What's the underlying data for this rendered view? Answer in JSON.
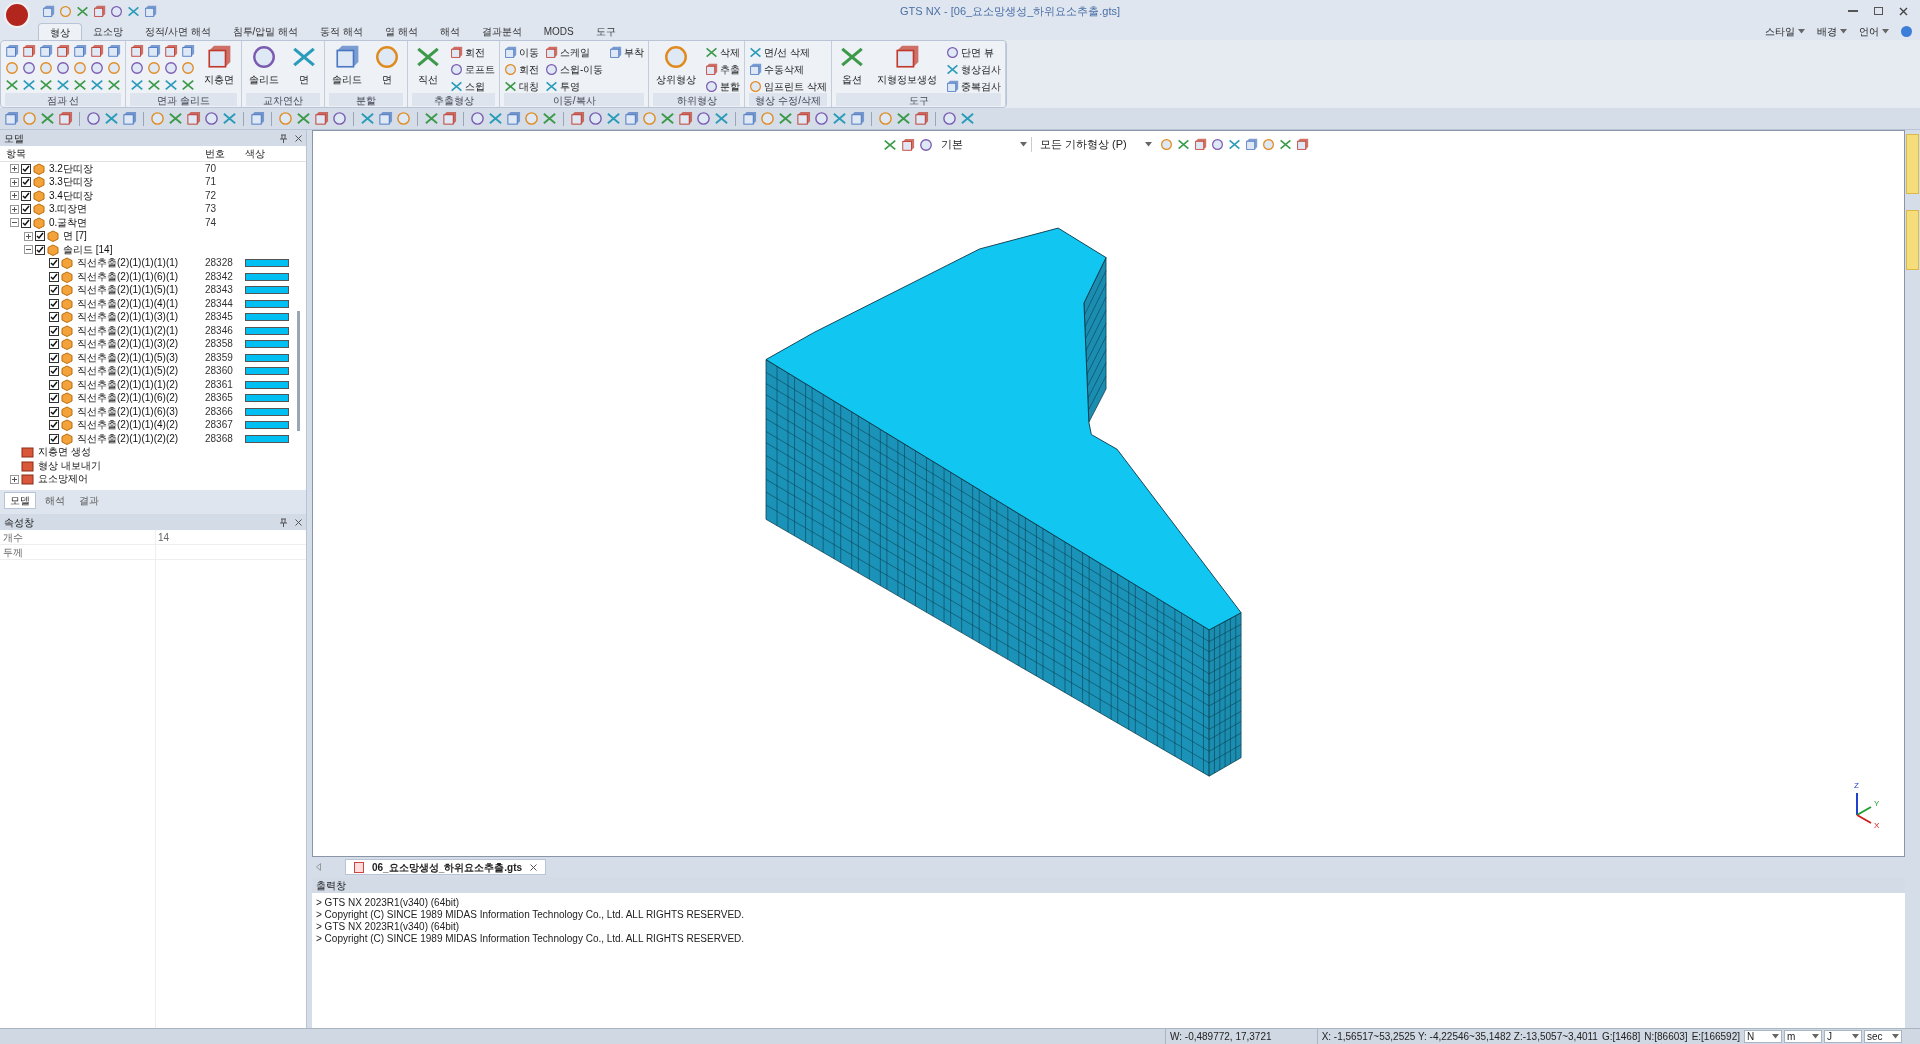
{
  "window": {
    "title": "GTS NX - [06_요소망생성_하위요소추출.gts]"
  },
  "menu_tabs": [
    {
      "label": "형상",
      "selected": true
    },
    {
      "label": "요소망",
      "selected": false
    },
    {
      "label": "정적/사면 해석",
      "selected": false
    },
    {
      "label": "침투/압밀 해석",
      "selected": false
    },
    {
      "label": "동적 해석",
      "selected": false
    },
    {
      "label": "열 해석",
      "selected": false
    },
    {
      "label": "해석",
      "selected": false
    },
    {
      "label": "결과분석",
      "selected": false
    },
    {
      "label": "MODS",
      "selected": false
    },
    {
      "label": "도구",
      "selected": false
    }
  ],
  "top_right_menus": [
    "스타일",
    "배경",
    "언어"
  ],
  "ribbon_groups": [
    {
      "label": "점과 선"
    },
    {
      "label": "면과 솔리드",
      "large": [
        "지층면"
      ]
    },
    {
      "label": "교차연산",
      "large": [
        "솔리드",
        "면"
      ]
    },
    {
      "label": "분할",
      "large": [
        "솔리드",
        "면"
      ]
    },
    {
      "label": "추출형상",
      "large": [
        "직선"
      ],
      "small": [
        "회전",
        "로프트",
        "스윕"
      ]
    },
    {
      "label": "이동/복사",
      "small": [
        "이동",
        "회전",
        "대칭",
        "스케일",
        "스윕-이동",
        "투영",
        "부착"
      ]
    },
    {
      "label": "하위형상",
      "large": [
        "상위형상"
      ],
      "small": [
        "삭제",
        "추출",
        "분할"
      ]
    },
    {
      "label": "형상 수정/삭제",
      "small": [
        "면/선 삭제",
        "수동삭제",
        "임프린트 삭제"
      ]
    },
    {
      "label": "도구",
      "large": [
        "옵션",
        "지형정보생성"
      ],
      "small": [
        "단면 뷰",
        "형상검사",
        "중복검사"
      ]
    }
  ],
  "model_panel": {
    "title": "모델",
    "columns": [
      "항목",
      "번호",
      "색상"
    ],
    "tree": [
      {
        "kind": "group",
        "label": "3.2단띠장",
        "number": "70",
        "checked": true,
        "expanded": false
      },
      {
        "kind": "group",
        "label": "3.3단띠장",
        "number": "71",
        "checked": true,
        "expanded": false
      },
      {
        "kind": "group",
        "label": "3.4단띠장",
        "number": "72",
        "checked": true,
        "expanded": false
      },
      {
        "kind": "group",
        "label": "3.띠장면",
        "number": "73",
        "checked": true,
        "expanded": false
      },
      {
        "kind": "group",
        "label": "0.굴착면",
        "number": "74",
        "checked": true,
        "expanded": true,
        "children": [
          {
            "kind": "group",
            "label": "면 [7]",
            "checked": true,
            "expanded": false
          },
          {
            "kind": "group",
            "label": "솔리드 [14]",
            "checked": true,
            "expanded": true,
            "children": [
              {
                "kind": "solid",
                "label": "직선추출(2)(1)(1)(1)(1)",
                "number": "28328",
                "checked": true,
                "color": "#00bff3"
              },
              {
                "kind": "solid",
                "label": "직선추출(2)(1)(1)(6)(1)",
                "number": "28342",
                "checked": true,
                "color": "#00bff3"
              },
              {
                "kind": "solid",
                "label": "직선추출(2)(1)(1)(5)(1)",
                "number": "28343",
                "checked": true,
                "color": "#00bff3"
              },
              {
                "kind": "solid",
                "label": "직선추출(2)(1)(1)(4)(1)",
                "number": "28344",
                "checked": true,
                "color": "#00bff3"
              },
              {
                "kind": "solid",
                "label": "직선추출(2)(1)(1)(3)(1)",
                "number": "28345",
                "checked": true,
                "color": "#00bff3"
              },
              {
                "kind": "solid",
                "label": "직선추출(2)(1)(1)(2)(1)",
                "number": "28346",
                "checked": true,
                "color": "#00bff3"
              },
              {
                "kind": "solid",
                "label": "직선추출(2)(1)(1)(3)(2)",
                "number": "28358",
                "checked": true,
                "color": "#00bff3"
              },
              {
                "kind": "solid",
                "label": "직선추출(2)(1)(1)(5)(3)",
                "number": "28359",
                "checked": true,
                "color": "#00bff3"
              },
              {
                "kind": "solid",
                "label": "직선추출(2)(1)(1)(5)(2)",
                "number": "28360",
                "checked": true,
                "color": "#00bff3"
              },
              {
                "kind": "solid",
                "label": "직선추출(2)(1)(1)(1)(2)",
                "number": "28361",
                "checked": true,
                "color": "#00bff3"
              },
              {
                "kind": "solid",
                "label": "직선추출(2)(1)(1)(6)(2)",
                "number": "28365",
                "checked": true,
                "color": "#00bff3"
              },
              {
                "kind": "solid",
                "label": "직선추출(2)(1)(1)(6)(3)",
                "number": "28366",
                "checked": true,
                "color": "#00bff3"
              },
              {
                "kind": "solid",
                "label": "직선추출(2)(1)(1)(4)(2)",
                "number": "28367",
                "checked": true,
                "color": "#00bff3"
              },
              {
                "kind": "solid",
                "label": "직선추출(2)(1)(1)(2)(2)",
                "number": "28368",
                "checked": true,
                "color": "#00bff3"
              }
            ]
          }
        ]
      },
      {
        "kind": "tool",
        "label": "지층면 생성"
      },
      {
        "kind": "tool",
        "label": "형상 내보내기"
      },
      {
        "kind": "tool",
        "label": "요소망제어",
        "expanded": false
      }
    ]
  },
  "panel_tabs": [
    {
      "label": "모델",
      "selected": true
    },
    {
      "label": "해석",
      "selected": false
    },
    {
      "label": "결과",
      "selected": false
    }
  ],
  "property_panel": {
    "title": "속성창",
    "rows": [
      {
        "name": "개수",
        "value": "14"
      },
      {
        "name": "두께"
      }
    ]
  },
  "viewport_toolbar": {
    "filter": "기본",
    "geometry": "모든 기하형상 (P)"
  },
  "axes": [
    "Z",
    "Y",
    "X"
  ],
  "document_tab": "06_요소망생성_하위요소추출.gts",
  "output_panel": {
    "title": "출력창",
    "lines": [
      "> GTS NX 2023R1(v340) (64bit)",
      "> Copyright (C) SINCE 1989 MIDAS Information Technology Co., Ltd. ALL RIGHTS RESERVED.",
      "> GTS NX 2023R1(v340) (64bit)",
      "> Copyright (C) SINCE 1989 MIDAS Information Technology Co., Ltd. ALL RIGHTS RESERVED."
    ]
  },
  "status_bar": {
    "cursor": "W: -0,489772, 17,3721",
    "range": "X: -1,56517~53,2525 Y: -4,22546~35,1482 Z:-13,5057~3,4011",
    "counts": [
      "G:[1468]",
      "N:[86603]",
      "E:[166592]"
    ],
    "units": [
      "N",
      "m",
      "J",
      "sec"
    ]
  }
}
